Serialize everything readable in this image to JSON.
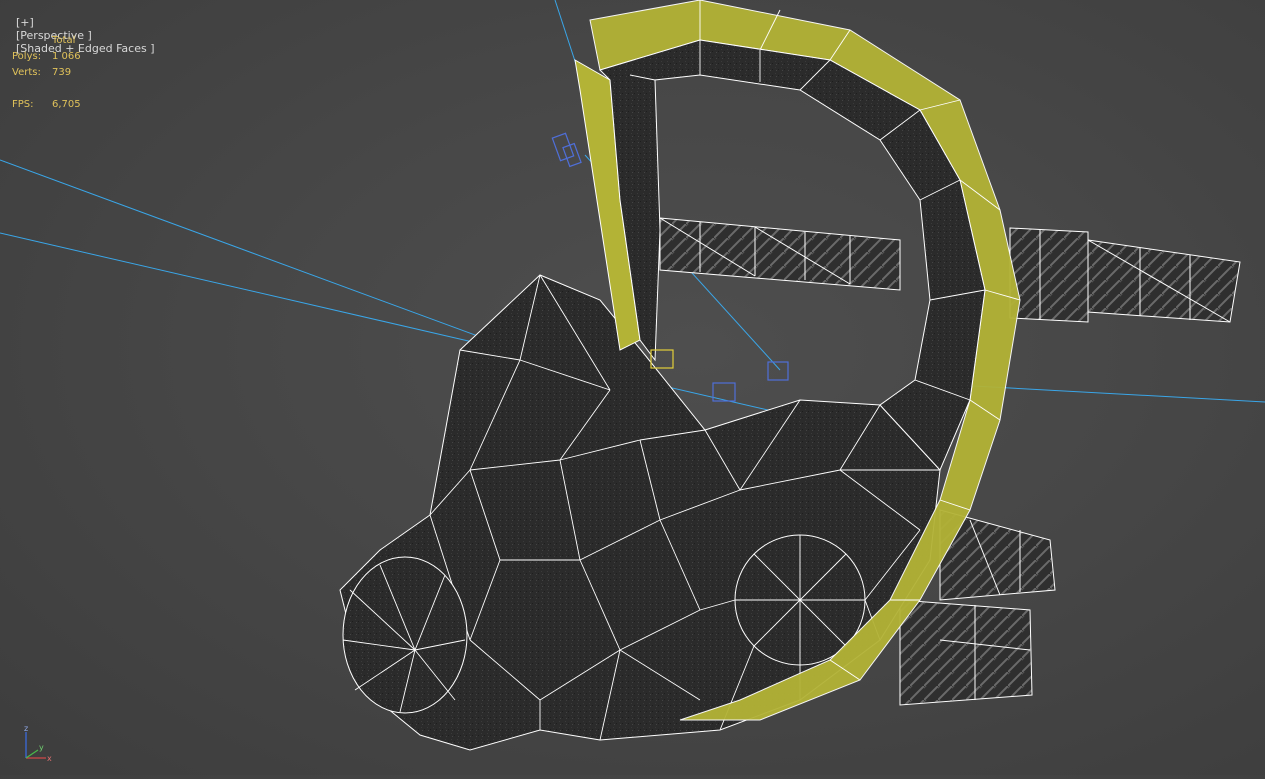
{
  "viewport": {
    "menu_plus": "[+]",
    "view_name": "[Perspective ]",
    "shading_mode": "[Shaded + Edged Faces ]"
  },
  "stats": {
    "header": "Total",
    "polys_label": "Polys:",
    "polys_value": "1 066",
    "verts_label": "Verts:",
    "verts_value": "739",
    "fps_label": "FPS:",
    "fps_value": "6,705"
  },
  "axis_gizmo": {
    "z_label": "z",
    "x_label": "x",
    "y_label": "y"
  },
  "colors": {
    "background": "#474747",
    "stats_text": "#e0c25a",
    "wire": "#ffffff",
    "mesh_dark": "#2a2a2a",
    "frame_yellow": "#b8b838",
    "helper_blue": "#3aa6e8"
  },
  "icons": {
    "gizmo": "axis-tripod-icon"
  }
}
